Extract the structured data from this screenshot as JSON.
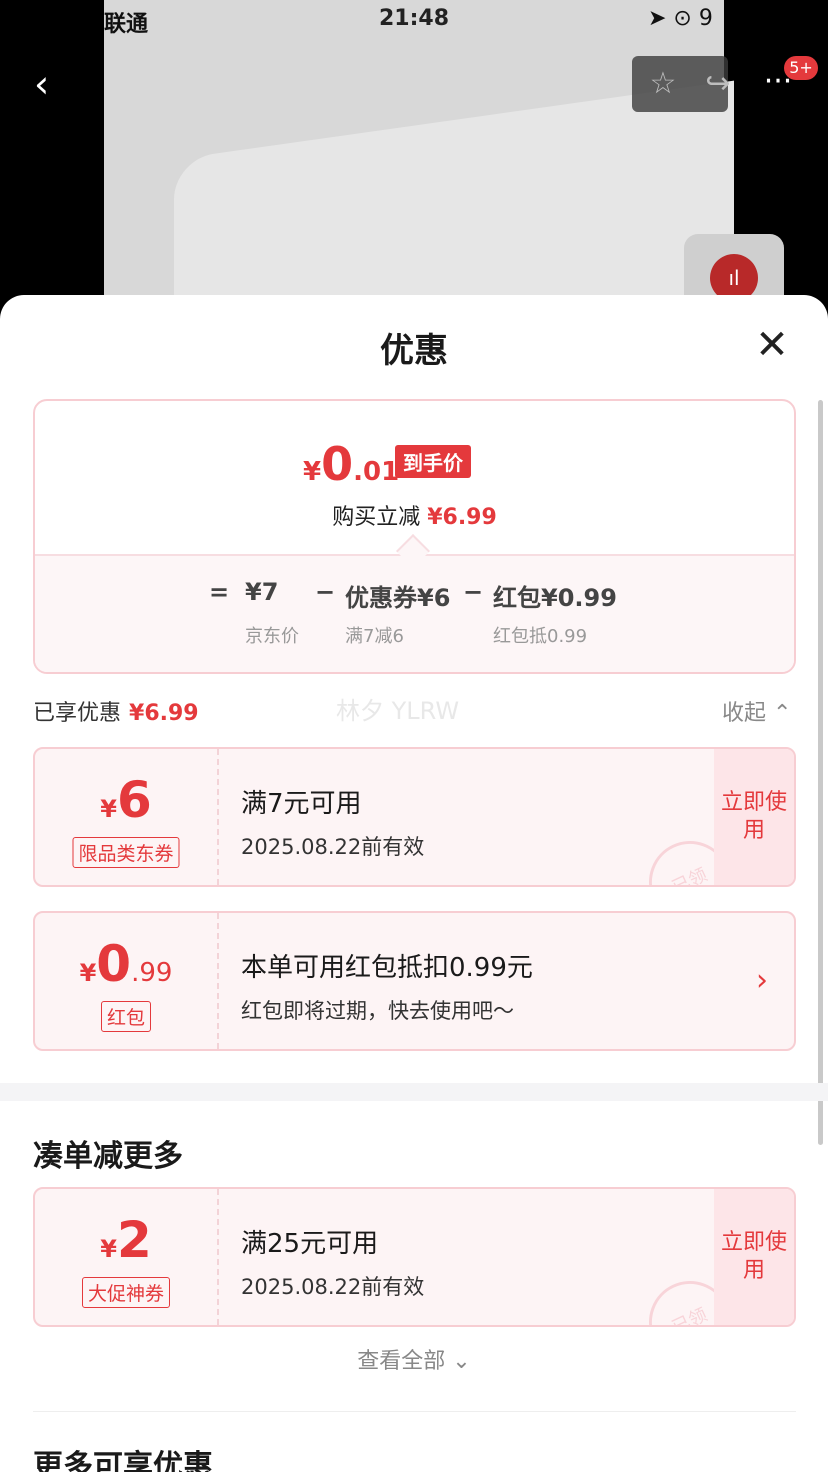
{
  "status_bar": {
    "carrier": "联通",
    "time": "21:48",
    "right": "➤ ⊙ 9"
  },
  "topbar": {
    "back": "‹",
    "more": "···",
    "badge": "5+"
  },
  "sheet": {
    "title": "优惠",
    "price": {
      "yen": "¥",
      "int": "0",
      "dec": ".01",
      "tag": "到手价"
    },
    "reduce": {
      "label": "购买立减",
      "amount": "¥6.99"
    },
    "formula": {
      "eq": "=",
      "jd_price": "¥7",
      "jd_price_label": "京东价",
      "minus1": "−",
      "coupon": "优惠券¥6",
      "coupon_label": "满7减6",
      "minus2": "−",
      "hongbao": "红包¥0.99",
      "hongbao_label": "红包抵0.99"
    },
    "enjoyed": {
      "label": "已享优惠",
      "amount": "¥6.99",
      "collapse": "收起 ⌃"
    },
    "watermark": "林夕 YLRW",
    "coupons": [
      {
        "yen": "¥",
        "int": "6",
        "dec": "",
        "kind": "限品类东券",
        "title": "满7元可用",
        "sub": "2025.08.22前有效",
        "action": "立即使用",
        "stamp": "已领"
      },
      {
        "yen": "¥",
        "int": "0",
        "dec": ".99",
        "kind": "红包",
        "title": "本单可用红包抵扣0.99元",
        "sub": "红包即将过期，快去使用吧～",
        "arrow": "›"
      }
    ],
    "section_more_savings": "凑单减更多",
    "coupon3": {
      "yen": "¥",
      "int": "2",
      "kind": "大促神券",
      "title": "满25元可用",
      "sub": "2025.08.22前有效",
      "action": "立即使用",
      "stamp": "已领"
    },
    "view_all": "查看全部 ⌄",
    "section_more": "更多可享优惠"
  }
}
